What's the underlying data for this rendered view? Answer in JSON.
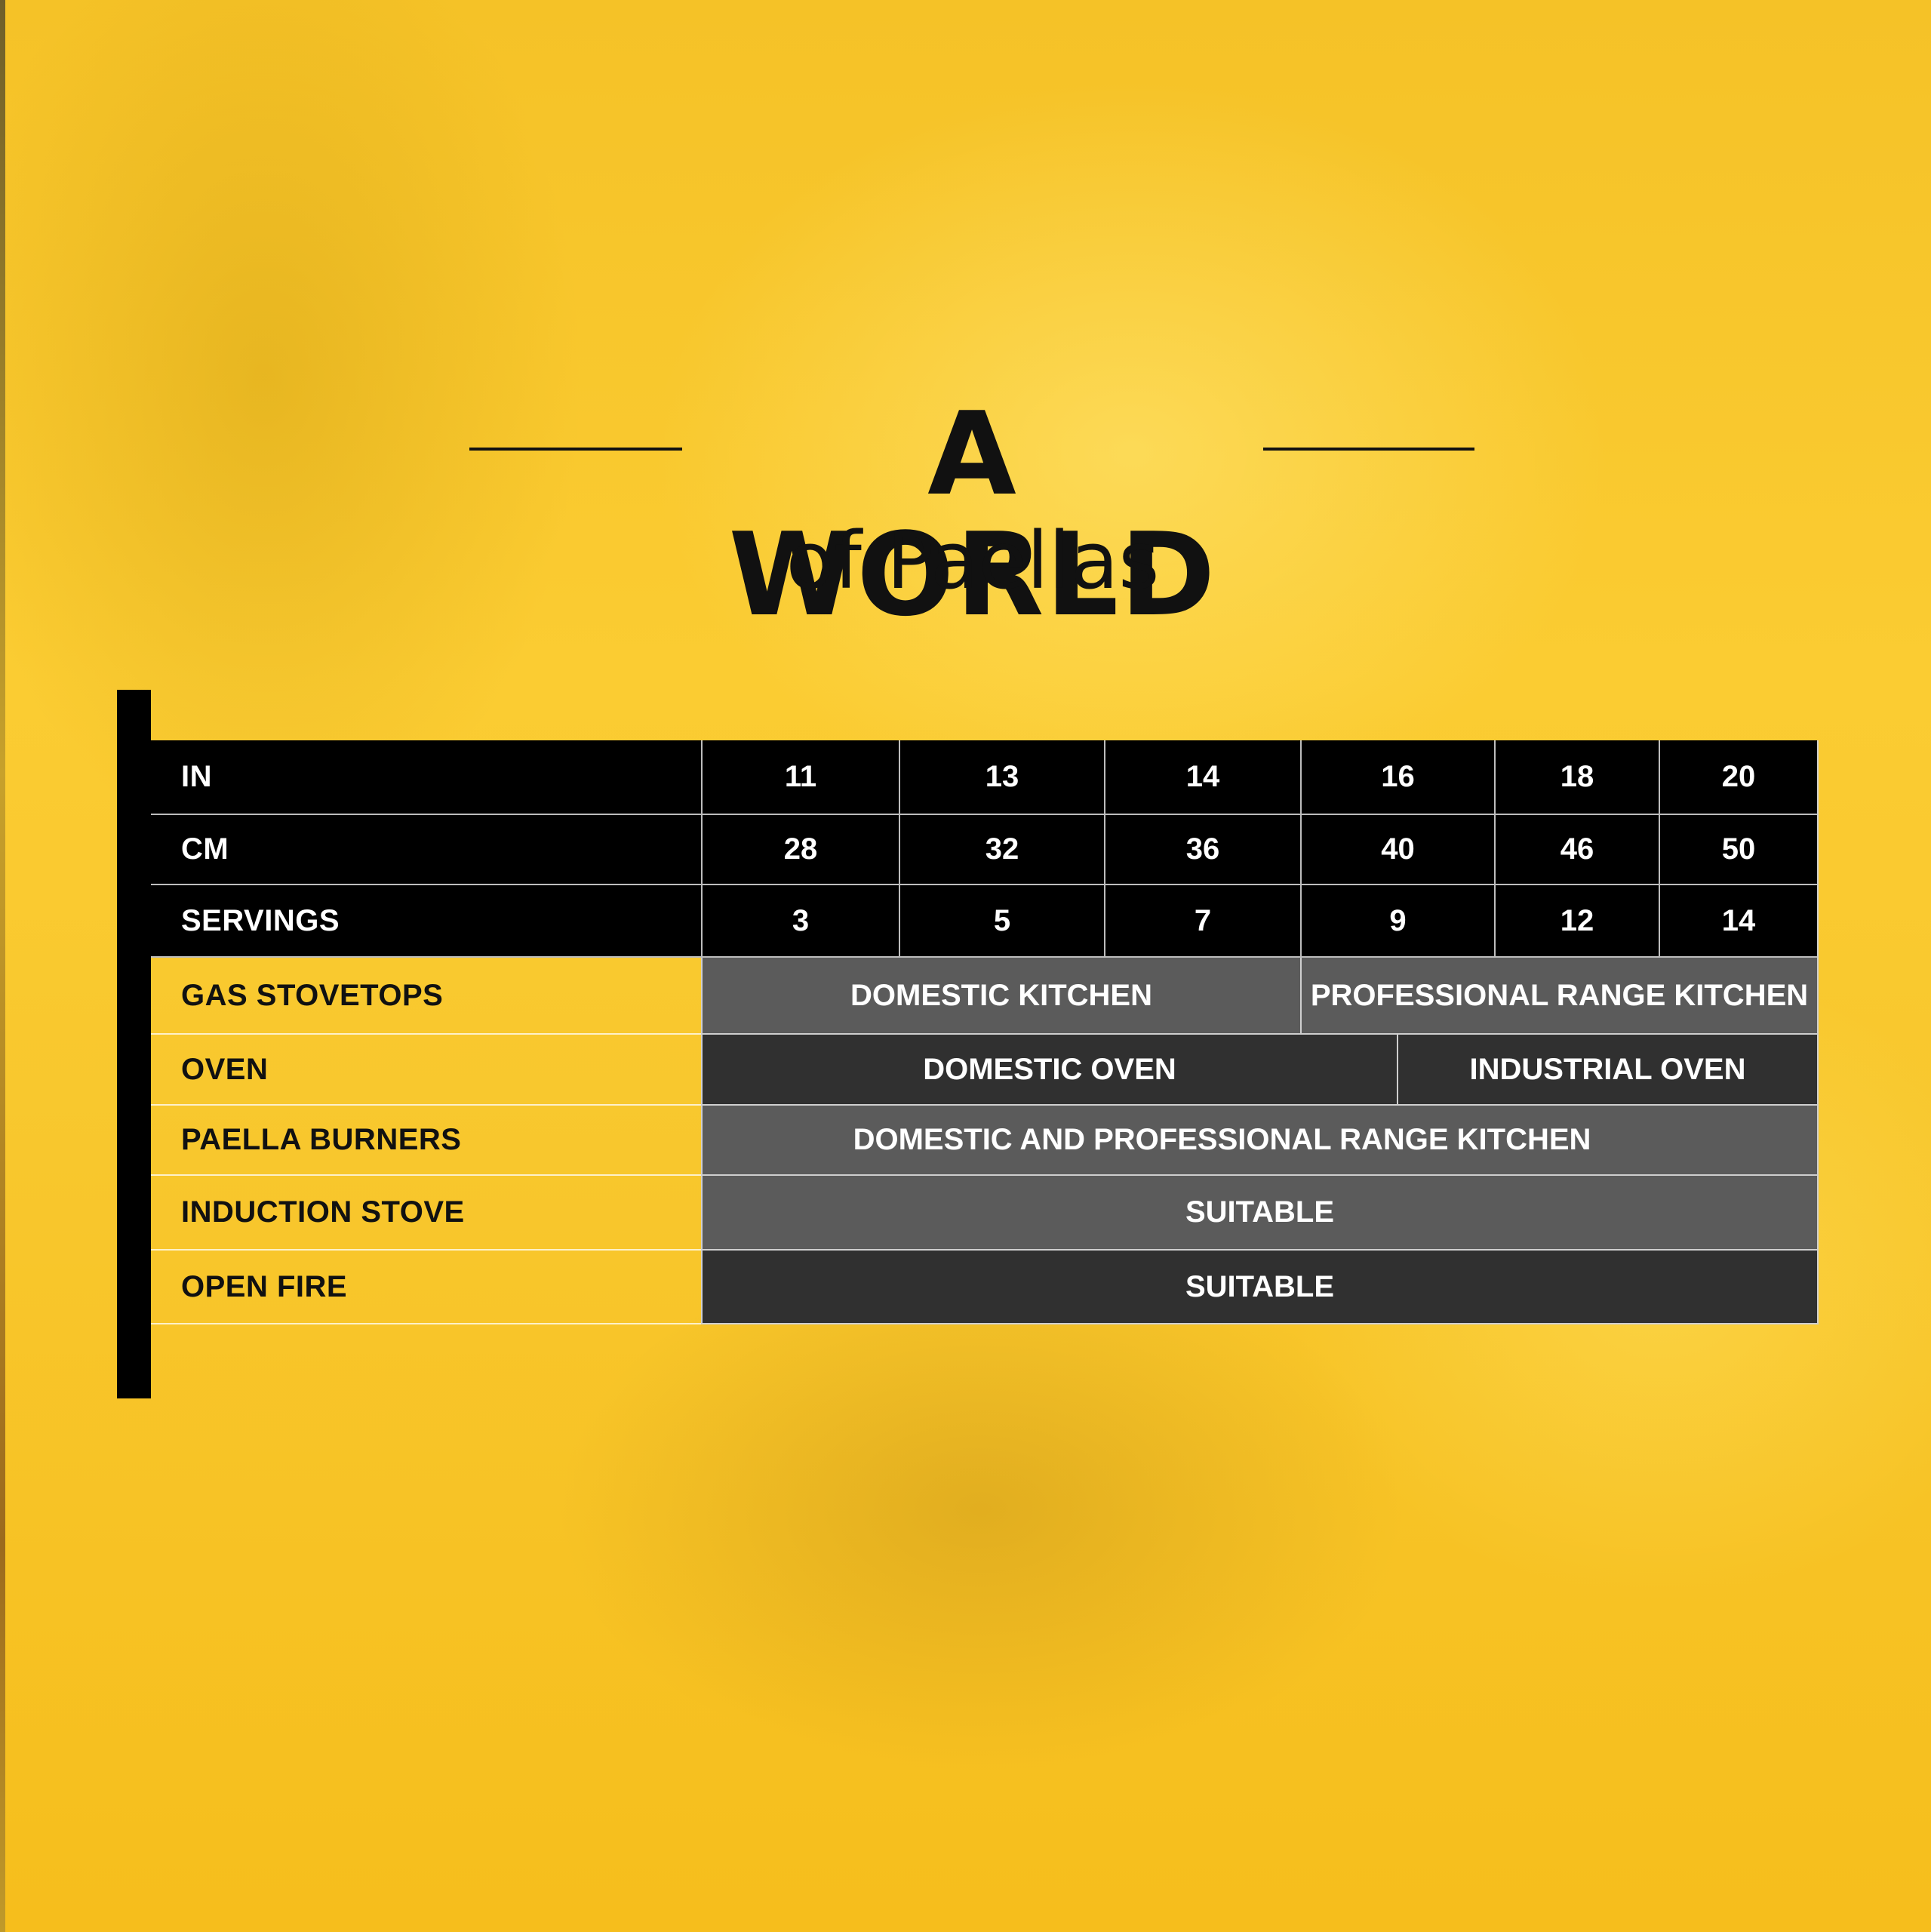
{
  "title": {
    "main": "A WORLD",
    "sub": "of Paellas"
  },
  "header_rows": [
    {
      "label": "IN",
      "values": [
        "11",
        "13",
        "14",
        "16",
        "18",
        "20"
      ]
    },
    {
      "label": "CM",
      "values": [
        "28",
        "32",
        "36",
        "40",
        "46",
        "50"
      ]
    },
    {
      "label": "SERVINGS",
      "values": [
        "3",
        "5",
        "7",
        "9",
        "12",
        "14"
      ]
    }
  ],
  "usage_rows": [
    {
      "label": "GAS STOVETOPS",
      "cells": [
        "DOMESTIC KITCHEN",
        "PROFESSIONAL RANGE KITCHEN"
      ]
    },
    {
      "label": "OVEN",
      "cells": [
        "DOMESTIC OVEN",
        "INDUSTRIAL OVEN"
      ]
    },
    {
      "label": "PAELLA BURNERS",
      "cells": [
        "DOMESTIC AND PROFESSIONAL RANGE KITCHEN"
      ]
    },
    {
      "label": "INDUCTION STOVE",
      "cells": [
        "SUITABLE"
      ]
    },
    {
      "label": "OPEN FIRE",
      "cells": [
        "SUITABLE"
      ]
    }
  ],
  "colors": {
    "background": "#f8c72d",
    "header_row": "#000000",
    "cell_gray": "#5b5b5b",
    "cell_dark_gray": "#303030",
    "text_dark": "#111111",
    "text_light": "#ffffff"
  }
}
